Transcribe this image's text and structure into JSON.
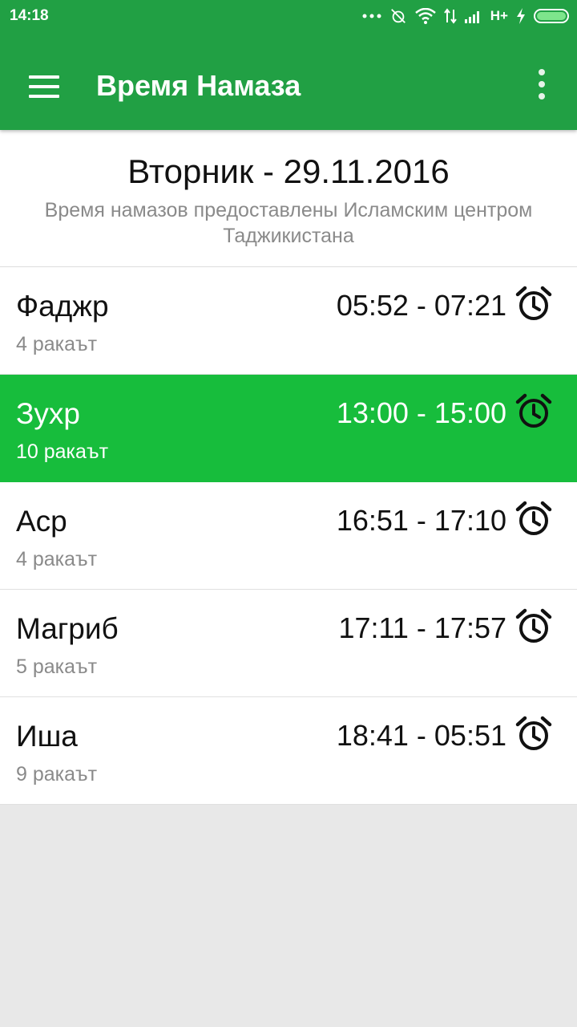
{
  "status_bar": {
    "time": "14:18",
    "network": "H+"
  },
  "toolbar": {
    "title": "Время Намаза"
  },
  "header": {
    "date": "Вторник - 29.11.2016",
    "source": "Время намазов предоставлены Исламским центром Таджикистана"
  },
  "prayers": [
    {
      "name": "Фаджр",
      "rakat": "4 ракаът",
      "time": "05:52 - 07:21"
    },
    {
      "name": "Зухр",
      "rakat": "10 ракаът",
      "time": "13:00 - 15:00"
    },
    {
      "name": "Аср",
      "rakat": "4 ракаът",
      "time": "16:51 - 17:10"
    },
    {
      "name": "Магриб",
      "rakat": "5 ракаът",
      "time": "17:11 - 17:57"
    },
    {
      "name": "Иша",
      "rakat": "9 ракаът",
      "time": "18:41 - 05:51"
    }
  ],
  "colors": {
    "primary": "#21a044",
    "active_row": "#17bd3c",
    "background": "#e8e8e8"
  }
}
